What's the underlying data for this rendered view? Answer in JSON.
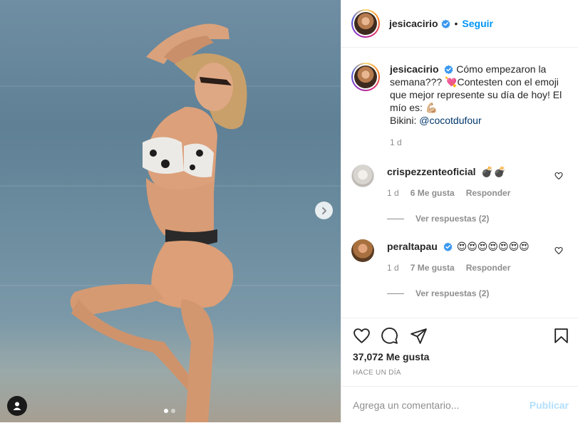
{
  "post": {
    "username": "jesicacirio",
    "follow_label": "Seguir",
    "follow_separator": "•"
  },
  "caption": {
    "username": "jesicacirio",
    "text_part1": " Cómo empezaron la semana??? ",
    "emoji_heart": "💘",
    "text_part2": "Contesten con el emoji que mejor represente su día de hoy! El mío es: ",
    "emoji_muscle": "💪🏼",
    "bikini_label": "Bikini: ",
    "bikini_mention": "@cocotdufour",
    "time": "1 d"
  },
  "comments": [
    {
      "username": "crispezzenteoficial",
      "text": "💣💣",
      "time": "1 d",
      "likes": "6 Me gusta",
      "reply_label": "Responder",
      "view_replies": "Ver respuestas (2)"
    },
    {
      "username": "peraltapau",
      "text": "😍😍😍😍😍😍😍",
      "time": "1 d",
      "likes": "7 Me gusta",
      "reply_label": "Responder",
      "view_replies": "Ver respuestas (2)"
    }
  ],
  "footer": {
    "likes": "37,072 Me gusta",
    "posted": "HACE UN DÍA",
    "comment_placeholder": "Agrega un comentario...",
    "publish_label": "Publicar"
  },
  "carousel": {
    "current": 1,
    "total": 2
  },
  "colors": {
    "accent": "#0095f6",
    "publish_disabled": "#b2dffc",
    "verified": "#3897f0",
    "muted": "#8e8e8e"
  },
  "icons": [
    "heart-icon",
    "comment-icon",
    "share-icon",
    "bookmark-icon",
    "verified-badge-icon",
    "chevron-right-icon",
    "user-tag-icon"
  ]
}
